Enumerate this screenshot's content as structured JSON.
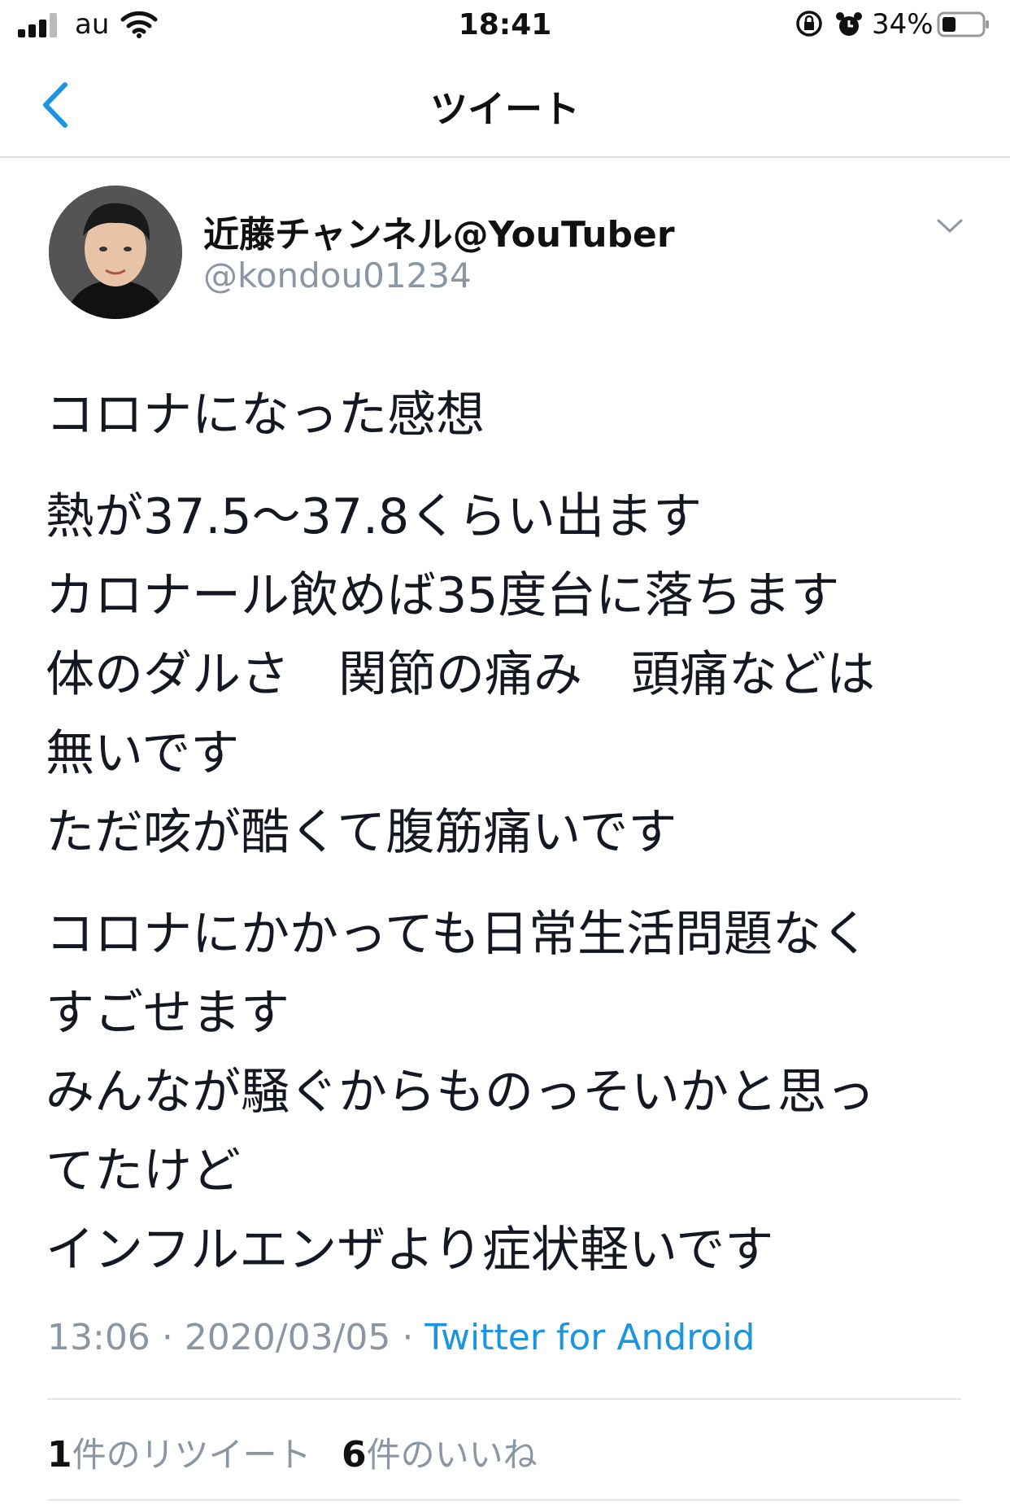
{
  "status_bar": {
    "carrier": "au",
    "time": "18:41",
    "battery_percent": "34%",
    "icons": [
      "signal-icon",
      "wifi-icon",
      "orientation-lock-icon",
      "alarm-icon",
      "battery-icon"
    ]
  },
  "nav": {
    "title": "ツイート",
    "back_icon": "chevron-left-icon",
    "accent_color": "#1b95e0"
  },
  "tweet": {
    "author": {
      "display_name": "近藤チャンネル@YouTuber",
      "handle": "@kondou01234"
    },
    "lines": [
      "コロナになった感想",
      "熱が37.5〜37.8くらい出ます",
      "カロナール飲めば35度台に落ちます",
      "体のダルさ　関節の痛み　頭痛などは",
      "無いです",
      "ただ咳が酷くて腹筋痛いです",
      "コロナにかかっても日常生活問題なく",
      "すごせます",
      "みんなが騒ぐからものっそいかと思っ",
      "てたけど",
      "インフルエンザより症状軽いです"
    ],
    "time": "13:06",
    "date": "2020/03/05",
    "separator": "·",
    "source": "Twitter for Android",
    "retweets_count": "1",
    "retweets_label": "件のリツイート",
    "likes_count": "6",
    "likes_label": "件のいいね"
  }
}
